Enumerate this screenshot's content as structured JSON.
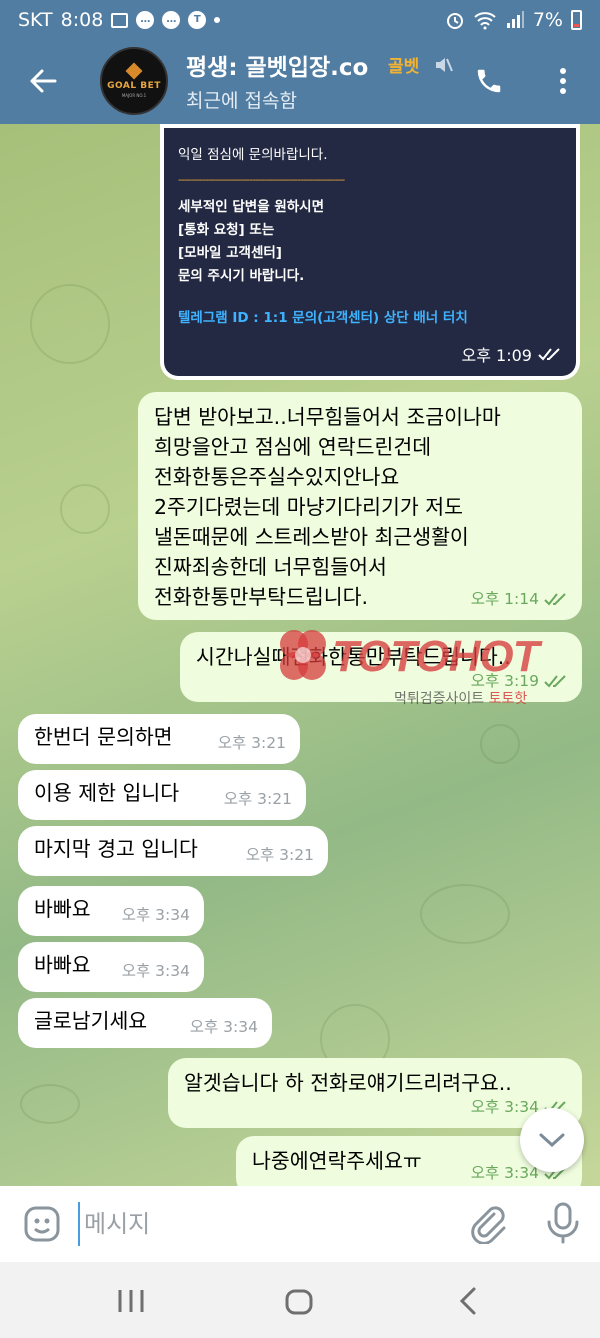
{
  "status_bar": {
    "carrier": "SKT",
    "time": "8:08",
    "battery": "7%"
  },
  "header": {
    "title": "평생: 골벳입장.co",
    "badge": "골벳",
    "subtitle": "최근에 접속함",
    "avatar_text": "GOAL BET",
    "avatar_subtext": "MAJOR NO.1"
  },
  "image_message": {
    "line1": "익일 점심에 문의바랍니다.",
    "separator": "--------------------------------------------------------",
    "bold_lines": [
      "세부적인 답변을 원하시면",
      "[통화 요청] 또는",
      "[모바일 고객센터]",
      "문의 주시기 바랍니다."
    ],
    "blue_line": "텔레그램 ID : 1:1 문의(고객센터) 상단 배너 터치",
    "time": "오후 1:09"
  },
  "messages": [
    {
      "dir": "out",
      "lines": [
        "답변 받아보고..너무힘들어서 조금이나마",
        "희망을안고 점심에 연락드린건데",
        "전화한통은주실수있지안나요",
        "2주기다렸는데 마냥기다리기가 저도",
        "낼돈때문에 스트레스받아 최근생활이",
        "진짜죄송한데 너무힘들어서",
        "전화한통만부탁드립니다."
      ],
      "time": "오후 1:14"
    },
    {
      "dir": "out",
      "lines": [
        "시간나실때전화한통만부탁드립니다.."
      ],
      "time": "오후 3:19"
    },
    {
      "dir": "in",
      "lines": [
        "한번더 문의하면"
      ],
      "time": "오후 3:21"
    },
    {
      "dir": "in",
      "lines": [
        "이용 제한 입니다"
      ],
      "time": "오후 3:21"
    },
    {
      "dir": "in",
      "lines": [
        "마지막 경고 입니다"
      ],
      "time": "오후 3:21"
    },
    {
      "dir": "in",
      "lines": [
        "바빠요"
      ],
      "time": "오후 3:34"
    },
    {
      "dir": "in",
      "lines": [
        "바빠요"
      ],
      "time": "오후 3:34"
    },
    {
      "dir": "in",
      "lines": [
        "글로남기세요"
      ],
      "time": "오후 3:34"
    },
    {
      "dir": "out",
      "lines": [
        "알겟습니다 하 전화로얘기드리려구요.."
      ],
      "time": "오후 3:34"
    },
    {
      "dir": "out",
      "lines": [
        "나중에연락주세요ㅠ"
      ],
      "time": "오후 3:34"
    }
  ],
  "watermark": {
    "brand": "TOTOHOT",
    "sub": "먹튀검증사이트",
    "sub_accent": "토토핫"
  },
  "input": {
    "placeholder": "메시지"
  },
  "icons": {
    "back": "arrow-left-icon",
    "call": "phone-icon",
    "menu": "more-vertical-icon",
    "emoji": "sticker-icon",
    "attach": "paperclip-icon",
    "mic": "microphone-icon",
    "scroll": "chevron-down-icon"
  },
  "colors": {
    "header": "#517da2",
    "outgoing_bubble": "#effdde",
    "incoming_bubble": "#ffffff",
    "read_ticks": "#6aa85e",
    "title_badge": "#f2b233"
  }
}
